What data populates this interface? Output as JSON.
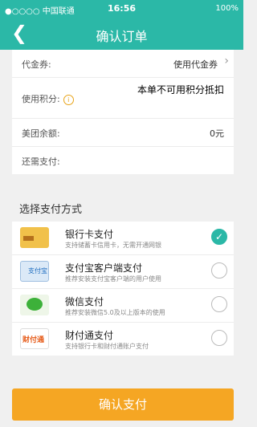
{
  "status": {
    "carrier": "●○○○○ 中国联通",
    "time": "16:56",
    "battery": "100%"
  },
  "nav": {
    "back_icon": "chevron-left-icon",
    "title": "确认订单"
  },
  "order": {
    "coupon_label": "代金券:",
    "coupon_value": "使用代金券",
    "points_label": "使用积分:",
    "points_value": "本单不可用积分抵扣",
    "balance_label": "美团余额:",
    "balance_value": "0元",
    "due_label": "还需支付:"
  },
  "payment": {
    "section_title": "选择支付方式",
    "methods": [
      {
        "name": "银行卡支付",
        "desc": "支持储蓄卡信用卡，无需开通网银",
        "selected": true
      },
      {
        "name": "支付宝客户端支付",
        "desc": "推荐安装支付宝客户端的用户使用",
        "selected": false
      },
      {
        "name": "微信支付",
        "desc": "推荐安装微信5.0及以上版本的使用",
        "selected": false
      },
      {
        "name": "财付通支付",
        "desc": "支持银行卡和财付通账户支付",
        "selected": false
      }
    ]
  },
  "confirm_label": "确认支付",
  "colors": {
    "accent": "#2bb8a7",
    "button": "#f5a623"
  }
}
